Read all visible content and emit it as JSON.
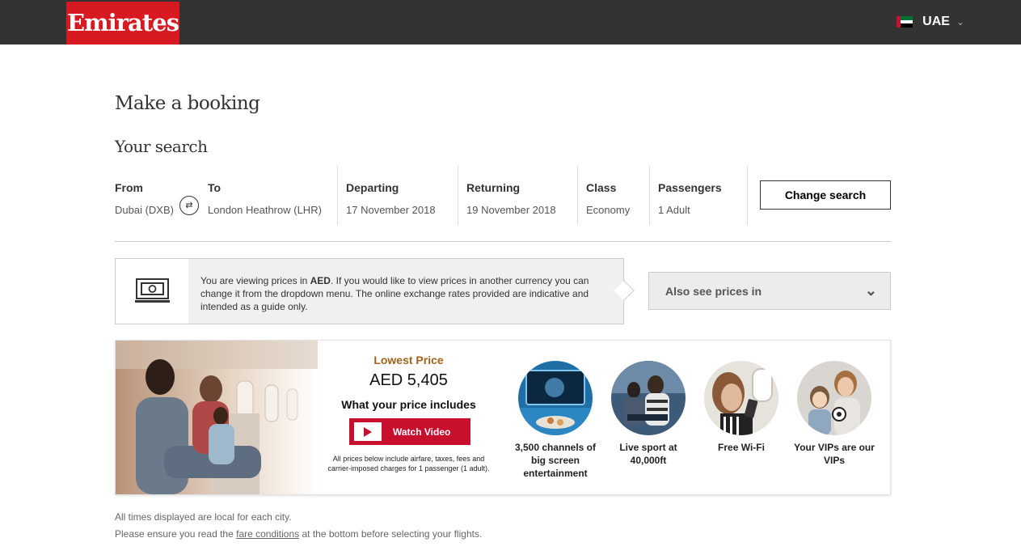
{
  "header": {
    "logo": "Emirates",
    "country": "UAE"
  },
  "page_title": "Make a booking",
  "search": {
    "title": "Your search",
    "from_label": "From",
    "from_value": "Dubai (DXB)",
    "to_label": "To",
    "to_value": "London Heathrow (LHR)",
    "departing_label": "Departing",
    "departing_value": "17 November 2018",
    "returning_label": "Returning",
    "returning_value": "19 November 2018",
    "class_label": "Class",
    "class_value": "Economy",
    "passengers_label": "Passengers",
    "passengers_value": "1 Adult",
    "change_button": "Change search"
  },
  "currency_notice": {
    "text_pre": "You are viewing prices in ",
    "currency": "AED",
    "text_post": ". If you would like to view prices in another currency you can change it from the dropdown menu. The online exchange rates provided are indicative and intended as a guide only."
  },
  "also_see": {
    "label": "Also see prices in"
  },
  "promo": {
    "lowest_label": "Lowest Price",
    "price": "AED 5,405",
    "includes_label": "What your price includes",
    "watch_label": "Watch Video",
    "fine_print": "All prices below include airfare, taxes, fees and carrier-imposed charges for 1 passenger (1 adult).",
    "features": [
      {
        "label": "3,500 channels of big screen entertainment"
      },
      {
        "label": "Live sport at 40,000ft"
      },
      {
        "label": "Free Wi-Fi"
      },
      {
        "label": "Your VIPs are our VIPs"
      }
    ]
  },
  "footer": {
    "line1": "All times displayed are local for each city.",
    "line2_pre": "Please ensure you read the ",
    "line2_link": "fare conditions",
    "line2_post": " at the bottom before selecting your flights."
  },
  "colors": {
    "brand_red": "#d71921",
    "header_bg": "#333333",
    "lowest_price": "#a0621c"
  }
}
